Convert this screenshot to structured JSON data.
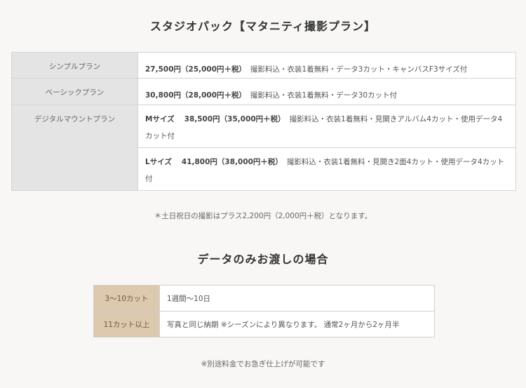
{
  "section1": {
    "title": "スタジオパック【マタニティ撮影プラン】",
    "plans": [
      {
        "name": "シンプルプラン",
        "price": "27,500円（25,000円＋税）",
        "desc": "撮影料込・衣装1着無料・データ3カット・キャンバスF3サイズ付"
      },
      {
        "name": "ベーシックプラン",
        "price": "30,800円（28,000円＋税）",
        "desc": "撮影料込・衣装1着無料・データ30カット付"
      },
      {
        "name": "デジタルマウントプラン",
        "options": [
          {
            "size": "Mサイズ",
            "price": "38,500円（35,000円＋税）",
            "desc": "撮影料込・衣装1着無料・見開きアルバム4カット・使用データ4カット付"
          },
          {
            "size": "Lサイズ",
            "price": "41,800円（38,000円＋税）",
            "desc": "撮影料込・衣装1着無料・見開き2面4カット・使用データ4カット付"
          }
        ]
      }
    ],
    "note": "＊土日祝日の撮影はプラス2,200円（2,000円＋税）となります。"
  },
  "section2": {
    "title": "データのみお渡しの場合",
    "rows": [
      {
        "label": "3〜10カット",
        "value": "1週間〜10日"
      },
      {
        "label": "11カット以上",
        "value": "写真と同じ納期 ※シーズンにより異なります。 通常2ヶ月から2ヶ月半"
      }
    ],
    "note": "※別途料金でお急ぎ仕上げが可能です"
  },
  "colors": {
    "background": "#f8f7f6",
    "plan_label_bg": "#e4e4e4",
    "cut_label_bg": "#dcc9ae",
    "border": "#d4d4d4"
  }
}
